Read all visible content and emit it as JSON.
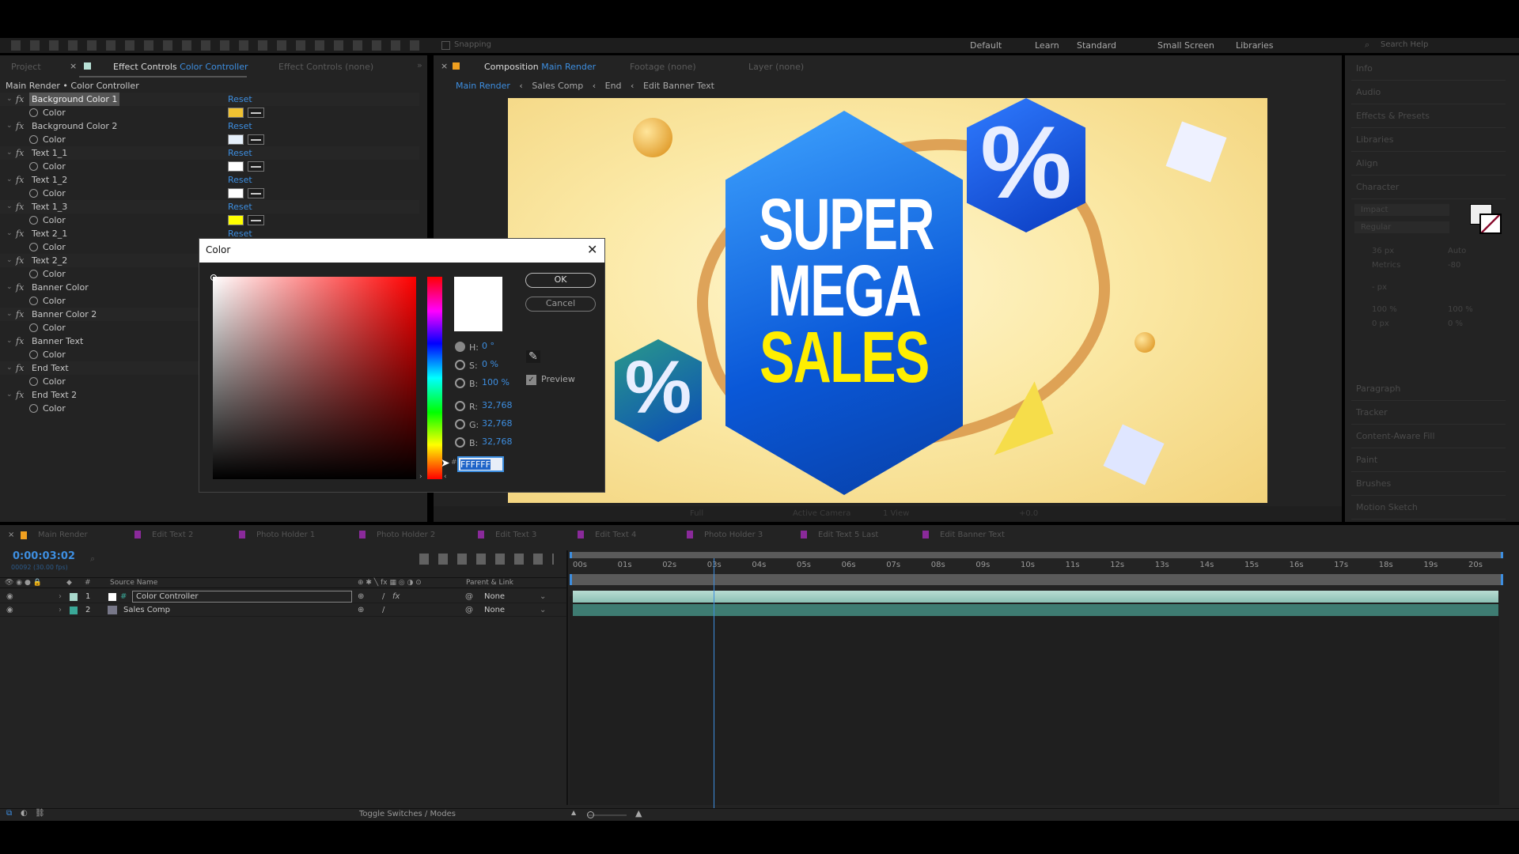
{
  "toolbar": {
    "snapping": "Snapping",
    "workspaces": [
      "Default",
      "Learn",
      "Standard",
      "Small Screen",
      "Libraries"
    ],
    "search_placeholder": "Search Help"
  },
  "left_panel": {
    "tabs": {
      "project": "Project",
      "effect_controls": "Effect Controls",
      "effect_controls_layer": "Color Controller",
      "effect_controls2": "Effect Controls",
      "effect_controls2_layer": "(none)"
    },
    "breadcrumb": "Main Render • Color Controller",
    "reset_label": "Reset",
    "property_label": "Color",
    "effects": [
      {
        "name": "Background Color 1",
        "swatch": "#f0c232"
      },
      {
        "name": "Background Color 2",
        "swatch": "#e6f0fb"
      },
      {
        "name": "Text 1_1",
        "swatch": "#ffffff"
      },
      {
        "name": "Text 1_2",
        "swatch": "#ffffff"
      },
      {
        "name": "Text 1_3",
        "swatch": "#ffff00"
      },
      {
        "name": "Text 2_1"
      },
      {
        "name": "Text 2_2"
      },
      {
        "name": "Banner Color"
      },
      {
        "name": "Banner Color 2"
      },
      {
        "name": "Banner Text"
      },
      {
        "name": "End Text"
      },
      {
        "name": "End Text 2"
      }
    ]
  },
  "composition": {
    "tabs": {
      "composition": "Composition",
      "composition_name": "Main Render",
      "footage": "Footage",
      "footage_val": "(none)",
      "layer": "Layer",
      "layer_val": "(none)"
    },
    "breadcrumb": [
      "Main Render",
      "Sales Comp",
      "End",
      "Edit Banner Text"
    ],
    "artwork": {
      "line1": "SUPER",
      "line2": "MEGA",
      "line3": "SALES",
      "badge": "%"
    },
    "viewer_bar": {
      "zoom": "Full",
      "camera": "Active Camera",
      "view": "1 View",
      "offset": "+0.0"
    }
  },
  "right_panel": {
    "items": [
      "Info",
      "Audio",
      "Effects & Presets",
      "Libraries",
      "Align",
      "Character",
      "Paragraph",
      "Tracker",
      "Content-Aware Fill",
      "Paint",
      "Brushes",
      "Motion Sketch"
    ],
    "character": {
      "font": "Impact",
      "style": "Regular",
      "size": "36 px",
      "leading": "Auto",
      "kerning": "Metrics",
      "tracking": "-80",
      "stroke": "- px",
      "vscale": "100 %",
      "hscale": "100 %",
      "baseline": "0 px",
      "tsume": "0 %"
    }
  },
  "color_dialog": {
    "title": "Color",
    "ok": "OK",
    "cancel": "Cancel",
    "preview": "Preview",
    "preview_checked": true,
    "fields": [
      {
        "label": "H:",
        "value": "0 °"
      },
      {
        "label": "S:",
        "value": "0 %"
      },
      {
        "label": "B:",
        "value": "100 %"
      },
      {
        "label": "R:",
        "value": "32,768"
      },
      {
        "label": "G:",
        "value": "32,768"
      },
      {
        "label": "B:",
        "value": "32,768"
      }
    ],
    "hex_label": "#",
    "hex": "FFFFFF",
    "current_color": "#ffffff",
    "hue_color": "#ff0000"
  },
  "timeline": {
    "comp_tabs": [
      "Main Render",
      "Edit Text 2",
      "Photo Holder 1",
      "Photo Holder 2",
      "Edit Text 3",
      "Edit Text 4",
      "Photo Holder 3",
      "Edit Text 5 Last",
      "Edit Banner Text"
    ],
    "timecode": "0:00:03:02",
    "frame_info": "00092 (30.00 fps)",
    "columns": {
      "num": "#",
      "source": "Source Name",
      "parent": "Parent & Link"
    },
    "ruler": [
      "00s",
      "01s",
      "02s",
      "03s",
      "04s",
      "05s",
      "06s",
      "07s",
      "08s",
      "09s",
      "10s",
      "11s",
      "12s",
      "13s",
      "14s",
      "15s",
      "16s",
      "17s",
      "18s",
      "19s",
      "20s"
    ],
    "playhead_seconds": 3.07,
    "duration_seconds": 20.7,
    "layers": [
      {
        "num": "1",
        "name": "Color Controller",
        "label_color": "#a8d8cc",
        "parent": "None"
      },
      {
        "num": "2",
        "name": "Sales Comp",
        "label_color": "#3aa898",
        "parent": "None"
      }
    ],
    "toggle_label": "Toggle Switches / Modes"
  }
}
